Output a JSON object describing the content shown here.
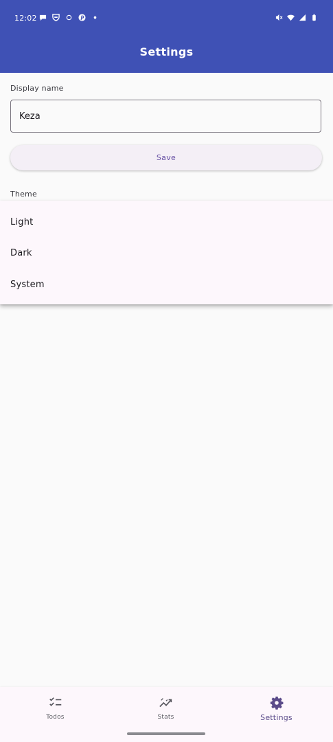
{
  "status_bar": {
    "time": "12:02",
    "left_icons": [
      "chat-bubble-icon",
      "shield-icon",
      "circle-icon",
      "pinterest-icon",
      "dot-icon"
    ],
    "right_icons": [
      "mute-icon",
      "wifi-icon",
      "cell-signal-icon",
      "battery-icon"
    ]
  },
  "app_bar": {
    "title": "Settings",
    "color": "#3f51b5"
  },
  "display_name": {
    "label": "Display name",
    "value": "Keza"
  },
  "save_button": {
    "label": "Save"
  },
  "theme": {
    "label": "Theme",
    "options": [
      "Light",
      "Dark",
      "System"
    ]
  },
  "bottom_nav": {
    "items": [
      {
        "label": "Todos",
        "icon": "checklist-icon"
      },
      {
        "label": "Stats",
        "icon": "trending-icon"
      },
      {
        "label": "Settings",
        "icon": "gear-icon"
      }
    ],
    "active": "Settings",
    "active_color": "#5b4b8a"
  }
}
